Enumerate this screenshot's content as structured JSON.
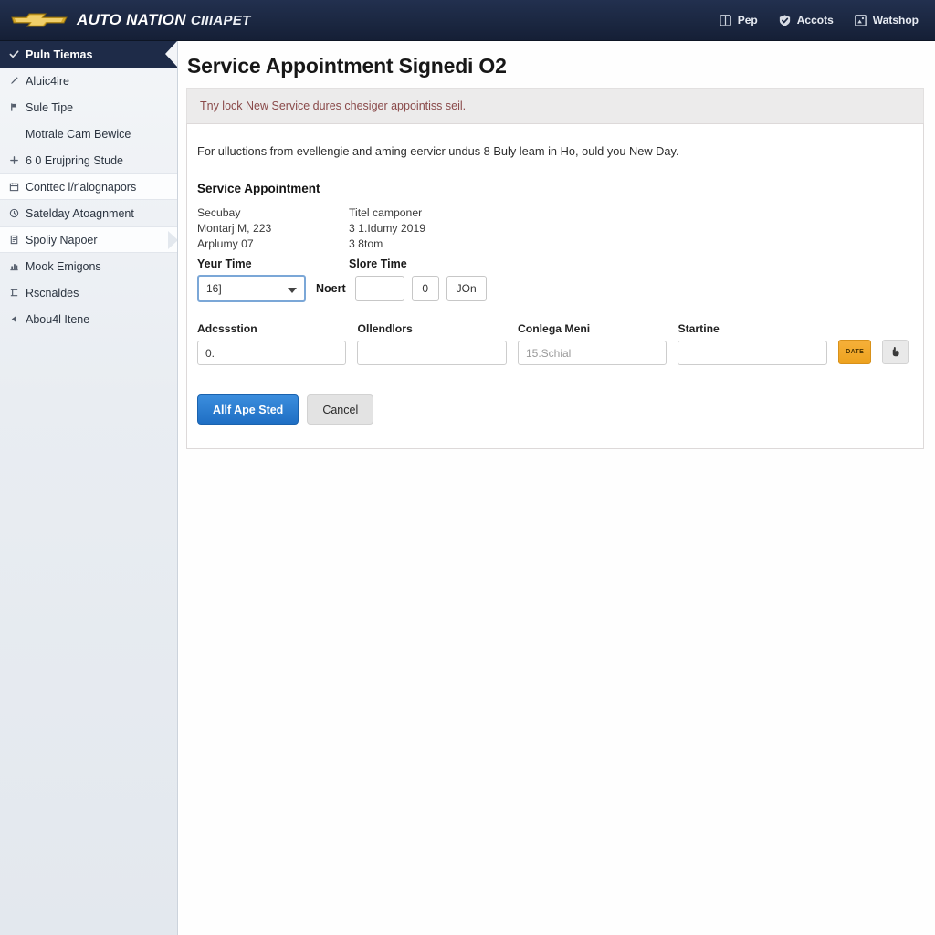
{
  "header": {
    "brand_primary": "AUTO NATION",
    "brand_secondary": "CIIIAPET",
    "logo_icon": "chevrolet-bowtie-icon",
    "nav": [
      {
        "label": "Pep",
        "icon": "book-icon"
      },
      {
        "label": "Accots",
        "icon": "shield-check-icon"
      },
      {
        "label": "Watshop",
        "icon": "window-icon"
      }
    ]
  },
  "sidebar": {
    "items": [
      {
        "label": "Puln Tiemas",
        "icon": "check-icon",
        "state": "active"
      },
      {
        "label": "Aluic4ire",
        "icon": "pencil-icon",
        "state": "normal"
      },
      {
        "label": "Sule Tipe",
        "icon": "flag-icon",
        "state": "normal"
      },
      {
        "label": "Motrale Cam Bewice",
        "icon": "none",
        "state": "plain"
      },
      {
        "label": "6 0 Erujpring Stude",
        "icon": "plus-icon",
        "state": "normal"
      },
      {
        "label": "Conttec l/r'alognapors",
        "icon": "calendar-icon",
        "state": "selected"
      },
      {
        "label": "Satelday Atoagnment",
        "icon": "clock-icon",
        "state": "normal"
      },
      {
        "label": "Spoliy Napoer",
        "icon": "report-icon",
        "state": "selected-arrow"
      },
      {
        "label": "Mook Emigons",
        "icon": "chart-icon",
        "state": "normal"
      },
      {
        "label": "Rscnaldes",
        "icon": "tools-icon",
        "state": "normal"
      },
      {
        "label": "Abou4l Itene",
        "icon": "back-arrow-icon",
        "state": "normal"
      }
    ]
  },
  "main": {
    "page_title": "Service Appointment Signedi O2",
    "alert_text": "Tny lock New Service dures chesiger appointiss seil.",
    "intro_text": "For ulluctions from evellengie and aming eervicr undus 8 Buly leam in Ho, ould you New Day.",
    "section_title": "Service Appointment",
    "info": {
      "left": [
        "Secubay",
        "Montarj M, 223",
        "Arplumy 07"
      ],
      "right": [
        "Titel camponer",
        "3 1.Idumy 2019",
        "3 8tom"
      ],
      "left_field_label": "Yeur Time",
      "right_field_label": "Slore Time"
    },
    "controls": {
      "select_value": "16]",
      "select_caret_icon": "chevron-down-icon",
      "inline_label": "Noert",
      "text_input_value": "",
      "mini_value_1": "0",
      "mini_value_2": "JOn"
    },
    "form_fields": [
      {
        "label": "Adcssstion",
        "value": "0.",
        "placeholder": ""
      },
      {
        "label": "Ollendlors",
        "value": "",
        "placeholder": ""
      },
      {
        "label": "Conlega Meni",
        "value": "",
        "placeholder": "15.Schial"
      },
      {
        "label": "Startine",
        "value": "",
        "placeholder": ""
      }
    ],
    "orange_button_label": "DATE",
    "gray_button_icon": "hand-pointer-icon",
    "actions": {
      "primary_label": "Allf Ape Sted",
      "secondary_label": "Cancel"
    }
  },
  "colors": {
    "header_navy": "#1b2741",
    "sidebar_active": "#1e2b48",
    "primary_blue": "#2f7ed0",
    "accent_orange": "#eda21e",
    "alert_text": "#8a4a4a",
    "bowtie_gold": "#d4a829"
  }
}
